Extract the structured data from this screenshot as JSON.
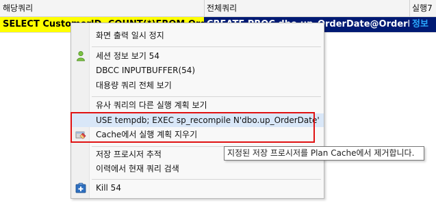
{
  "grid": {
    "columns": [
      "해당쿼리",
      "전체쿼리",
      "실행7"
    ],
    "row": {
      "query": "SELECT CustomerID, COUNT(*)FROM Ord...",
      "full_query": "CREATE PROC dbo.up_OrderDate@OrderD...",
      "plan": "정보"
    }
  },
  "context_menu": {
    "items": [
      {
        "label": "화면 출력 일시 정지",
        "icon": ""
      },
      {
        "label": "세션 정보 보기 54",
        "icon": "user-icon"
      },
      {
        "label": "DBCC INPUTBUFFER(54)",
        "icon": ""
      },
      {
        "label": "대용량 쿼리 전체 보기",
        "icon": ""
      },
      {
        "label": "유사 쿼리의 다른 실행 계획 보기",
        "icon": ""
      },
      {
        "label": "USE tempdb; EXEC sp_recompile  N'dbo.up_OrderDate'",
        "icon": ""
      },
      {
        "label": "Cache에서 실행 계획 지우기",
        "icon": "eraser-icon"
      },
      {
        "label": "저장 프로시저 추적",
        "icon": ""
      },
      {
        "label": "이력에서 현재 쿼리 검색",
        "icon": ""
      },
      {
        "label": "Kill 54",
        "icon": "kill-icon"
      }
    ]
  },
  "tooltip": {
    "text": "지정된 저장 프로시저를 Plan Cache에서 제거합니다."
  },
  "colors": {
    "highlight_cell": "#ffff00",
    "dark_cell": "#001a73",
    "annotation_box": "#e01010",
    "menu_hover": "#d9e7f8"
  }
}
